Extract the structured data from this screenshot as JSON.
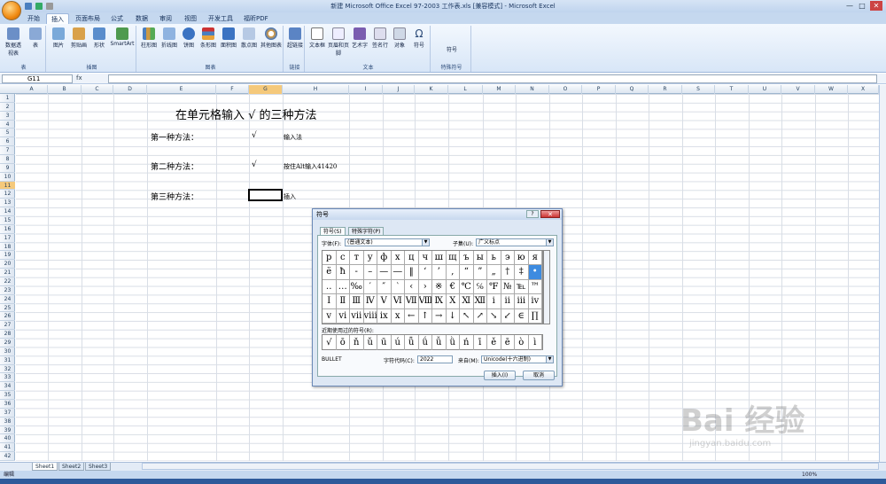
{
  "window": {
    "title": "新建 Microsoft Office Excel 97-2003 工作表.xls [兼容模式] - Microsoft Excel",
    "controls": [
      "—",
      "□",
      "✕"
    ]
  },
  "tabs": [
    "开始",
    "插入",
    "页面布局",
    "公式",
    "数据",
    "审阅",
    "视图",
    "开发工具",
    "福昕PDF"
  ],
  "active_tab": "插入",
  "ribbon": {
    "groups": [
      {
        "label": "表",
        "buttons": [
          "数据透视表",
          "表"
        ]
      },
      {
        "label": "插图",
        "buttons": [
          "图片",
          "剪贴画",
          "形状",
          "SmartArt"
        ]
      },
      {
        "label": "图表",
        "buttons": [
          "柱形图",
          "折线图",
          "饼图",
          "条形图",
          "面积图",
          "散点图",
          "其他图表"
        ]
      },
      {
        "label": "链接",
        "buttons": [
          "超链接"
        ]
      },
      {
        "label": "文本",
        "buttons": [
          "文本框",
          "页眉和页脚",
          "艺术字",
          "签名行",
          "对象",
          "符号"
        ]
      },
      {
        "label": "特殊符号",
        "buttons": [
          "符号"
        ]
      }
    ]
  },
  "formula_bar": {
    "name_box": "G11",
    "fx": "fx",
    "value": ""
  },
  "columns": [
    "A",
    "B",
    "C",
    "D",
    "E",
    "F",
    "G",
    "H",
    "I",
    "J",
    "K",
    "L",
    "M",
    "N",
    "O",
    "P",
    "Q",
    "R",
    "S",
    "T",
    "U",
    "V",
    "W",
    "X"
  ],
  "selected_column": "G",
  "rows": [
    "1",
    "2",
    "3",
    "4",
    "5",
    "6",
    "7",
    "8",
    "9",
    "10",
    "11",
    "12",
    "13",
    "14",
    "15",
    "16",
    "17",
    "18",
    "19",
    "20",
    "21",
    "22",
    "23",
    "24",
    "25",
    "26",
    "27",
    "28",
    "29",
    "30",
    "31",
    "32",
    "33",
    "34",
    "35",
    "36",
    "37",
    "38",
    "39",
    "40",
    "41",
    "42"
  ],
  "selected_row": "11",
  "cells": {
    "title": "在单元格输入 √ 的三种方法",
    "m1": "第一种方法：",
    "m1_sym": "√",
    "m1_note": "输入法",
    "m2": "第二种方法：",
    "m2_sym": "√",
    "m2_note": "按住Alt输入41420",
    "m3": "第三种方法：",
    "m3_note": "插入"
  },
  "sheets": [
    "Sheet1",
    "Sheet2",
    "Sheet3"
  ],
  "status": {
    "left": "编辑",
    "zoom": "100%"
  },
  "dialog": {
    "title": "符号",
    "help": "?",
    "close": "✕",
    "tabs": [
      "符号(S)",
      "特殊字符(P)"
    ],
    "font_label": "字体(F):",
    "font_value": "(普通文本)",
    "subset_label": "子集(U):",
    "subset_value": "广义标点",
    "symbols": [
      [
        "р",
        "с",
        "т",
        "у",
        "ф",
        "х",
        "ц",
        "ч",
        "ш",
        "щ",
        "ъ",
        "ы",
        "ь",
        "э",
        "ю",
        "я"
      ],
      [
        "ё",
        "ħ",
        "‐",
        "–",
        "—",
        "―",
        "‖",
        "‘",
        "’",
        "‚",
        "“",
        "”",
        "„",
        "†",
        "‡",
        "•"
      ],
      [
        "‥",
        "…",
        "‰",
        "′",
        "″",
        "‵",
        "‹",
        "›",
        "※",
        "€",
        "℃",
        "℅",
        "℉",
        "№",
        "℡",
        "™"
      ],
      [
        "Ⅰ",
        "Ⅱ",
        "Ⅲ",
        "Ⅳ",
        "Ⅴ",
        "Ⅵ",
        "Ⅶ",
        "Ⅷ",
        "Ⅸ",
        "Ⅹ",
        "Ⅺ",
        "Ⅻ",
        "ⅰ",
        "ⅱ",
        "ⅲ",
        "ⅳ"
      ],
      [
        "ⅴ",
        "ⅵ",
        "ⅶ",
        "ⅷ",
        "ⅸ",
        "ⅹ",
        "←",
        "↑",
        "→",
        "↓",
        "↖",
        "↗",
        "↘",
        "↙",
        "∈",
        "∏"
      ]
    ],
    "recent_label": "近期使用过的符号(R):",
    "recent": [
      "√",
      "ō",
      "ň",
      "ǔ",
      "ū",
      "ú",
      "ǖ",
      "ǘ",
      "ǚ",
      "ǜ",
      "ń",
      "ī",
      "ě",
      "ē",
      "ò",
      "ì"
    ],
    "char_name": "BULLET",
    "code_label": "字符代码(C):",
    "code_value": "2022",
    "from_label": "来自(M):",
    "from_value": "Unicode(十六进制)",
    "insert_button": "插入(I)",
    "cancel_button": "取消"
  },
  "watermark": {
    "text": "Bai 经验",
    "sub": "jingyan.baidu.com"
  }
}
